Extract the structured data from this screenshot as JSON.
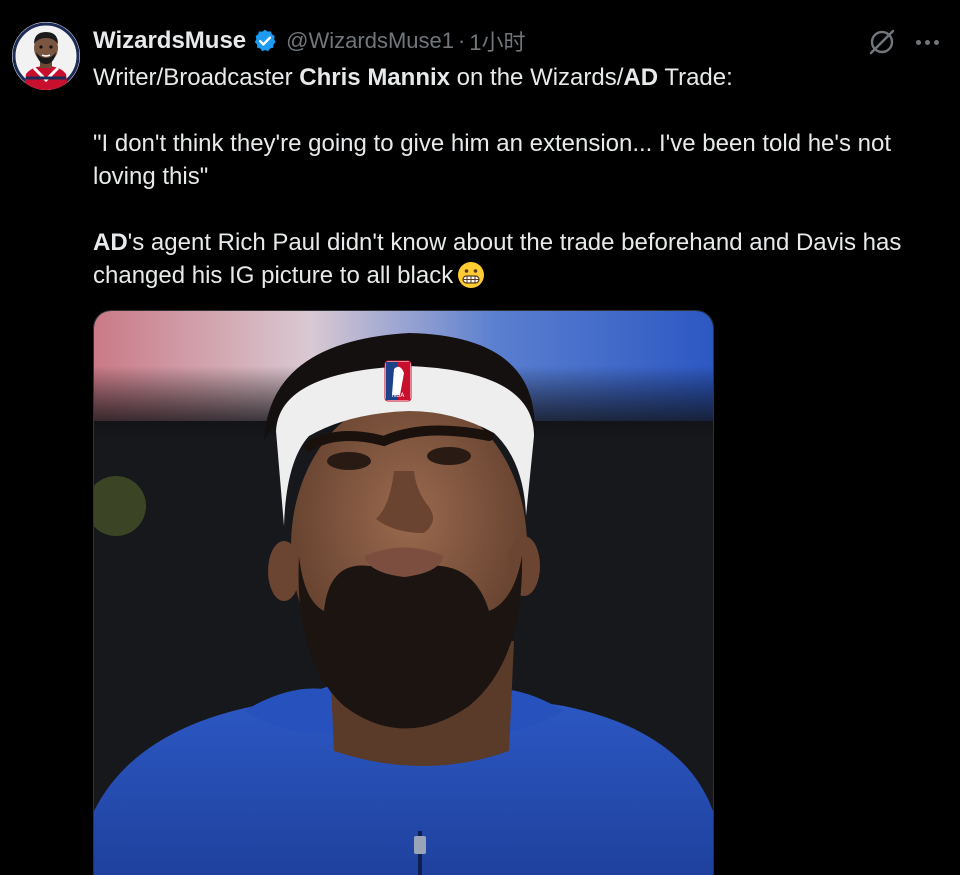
{
  "tweet": {
    "author": {
      "display_name": "WizardsMuse",
      "handle": "@WizardsMuse1",
      "verified": true,
      "avatar_icon": "cartoon-player-avatar-icon"
    },
    "separator": "·",
    "timestamp": "1小时",
    "actions": {
      "grok_icon": "grok-icon",
      "more_icon": "more-dots-icon"
    },
    "body": {
      "line1": {
        "part1": "Writer/Broadcaster ",
        "bold1": "Chris Mannix",
        "part2": " on the Wizards/",
        "bold2": "AD",
        "part3": " Trade:"
      },
      "quote": "\"I don't think they're going to give him an extension... I've been told he's not loving this\"",
      "line3": {
        "bold": "AD",
        "text": "'s agent Rich Paul didn't know about the trade beforehand and Davis has changed his IG picture to all black"
      },
      "emoji": "grimacing-face-emoji"
    },
    "media": {
      "type": "photo",
      "headband_logo": "NBA"
    }
  },
  "colors": {
    "background": "#000000",
    "text_primary": "#e7e9ea",
    "text_secondary": "#71767b",
    "verified_blue": "#1d9bf0",
    "media_border": "#2f3336"
  }
}
